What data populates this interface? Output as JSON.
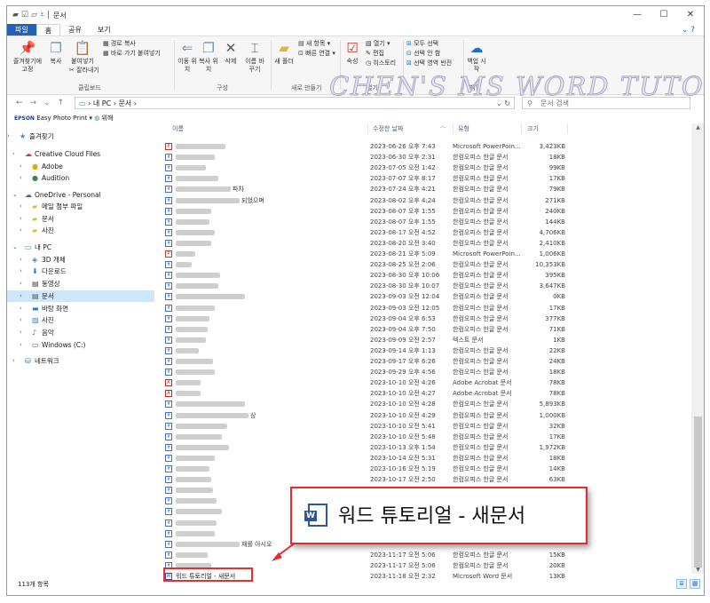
{
  "window": {
    "title": "문서",
    "minimize": "—",
    "maximize": "☐",
    "close": "✕"
  },
  "ribbon_tabs": [
    "파일",
    "홈",
    "공유",
    "보기"
  ],
  "ribbon": {
    "pin": "즐겨찾기에 고정",
    "copy": "복사",
    "paste": "붙여넣기",
    "copy_path": "경로 복사",
    "paste_shortcut": "바로 가기 붙여넣기",
    "cut": "잘라내기",
    "group_clipboard": "클립보드",
    "move": "이동 위치",
    "copy_to": "복사 위치",
    "delete": "삭제",
    "rename": "이름 바꾸기",
    "group_organize": "구성",
    "new_folder": "새 폴더",
    "new_item": "새 항목",
    "easy_access": "빠른 연결",
    "group_new": "새로 만들기",
    "properties": "속성",
    "open": "열기",
    "edit": "편집",
    "history": "히스토리",
    "group_open": "열기",
    "select_all": "모두 선택",
    "select_none": "선택 안 함",
    "invert_selection": "선택 영역 반전",
    "backup": "백업 시작",
    "group_backup": "백업"
  },
  "watermark": "CHEN'S MS WORD TUTORIAL",
  "address": {
    "path": "›  내 PC  ›  문서  ›",
    "search_placeholder": "문서 검색"
  },
  "epson": {
    "brand": "EPSON",
    "label": "Easy Photo Print",
    "extra": "위해"
  },
  "nav_pane": [
    {
      "label": "즐겨찾기",
      "icon": "★",
      "color": "#3b78d8",
      "chev": "›"
    },
    {
      "label": "Creative Cloud Files",
      "icon": "☁",
      "color": "#d33a2c",
      "chev": "›"
    },
    {
      "label": "Adobe",
      "icon": "●",
      "color": "#e0a800",
      "chev": "›"
    },
    {
      "label": "Audition",
      "icon": "●",
      "color": "#2e8b57",
      "chev": "›"
    },
    {
      "label": "OneDrive - Personal",
      "icon": "☁",
      "color": "#1f6fd1",
      "chev": "⌄"
    },
    {
      "label": "메일 첨부 파일",
      "icon": "▰",
      "color": "#e7b63a",
      "chev": "›"
    },
    {
      "label": "문서",
      "icon": "▰",
      "color": "#e7b63a",
      "chev": "›"
    },
    {
      "label": "사진",
      "icon": "▰",
      "color": "#e7b63a",
      "chev": "›"
    },
    {
      "label": "내 PC",
      "icon": "▭",
      "color": "#3a86d9",
      "chev": "⌄"
    },
    {
      "label": "3D 개체",
      "icon": "◈",
      "color": "#3a86d9",
      "chev": "›"
    },
    {
      "label": "다운로드",
      "icon": "⬇",
      "color": "#2a6fd0",
      "chev": "›"
    },
    {
      "label": "동영상",
      "icon": "▤",
      "color": "#444",
      "chev": "›"
    },
    {
      "label": "문서",
      "icon": "▤",
      "color": "#555",
      "chev": "›"
    },
    {
      "label": "바탕 화면",
      "icon": "▬",
      "color": "#2a79d2",
      "chev": "›"
    },
    {
      "label": "사진",
      "icon": "▨",
      "color": "#3a86d9",
      "chev": "›"
    },
    {
      "label": "음악",
      "icon": "♪",
      "color": "#2a6fd0",
      "chev": "›"
    },
    {
      "label": "Windows (C:)",
      "icon": "▭",
      "color": "#555",
      "chev": "›"
    },
    {
      "label": "네트워크",
      "icon": "⛁",
      "color": "#2a6fd0",
      "chev": "›"
    }
  ],
  "columns": {
    "name": "이름",
    "date": "수정한 날짜",
    "type": "유형",
    "size": "크기"
  },
  "files": [
    {
      "icon": "pp",
      "suffix": "",
      "date": "2023-06-26 오후 7:43",
      "type": "Microsoft PowerPoin...",
      "size": "3,423KB"
    },
    {
      "icon": "hwp",
      "suffix": "",
      "date": "2023-06-30 오후 2:31",
      "type": "한컴오피스 한글 문서",
      "size": "18KB"
    },
    {
      "icon": "hwp",
      "suffix": "",
      "date": "2023-07-05 오전 1:42",
      "type": "한컴오피스 한글 문서",
      "size": "99KB"
    },
    {
      "icon": "hwp",
      "suffix": "",
      "date": "2023-07-07 오후 8:17",
      "type": "한컴오피스 한글 문서",
      "size": "17KB"
    },
    {
      "icon": "hwp",
      "suffix": "파차",
      "date": "2023-07-24 오후 4:21",
      "type": "한컴오피스 한글 문서",
      "size": "79KB"
    },
    {
      "icon": "hwp",
      "suffix": "되었으며",
      "date": "2023-08-02 오후 4:24",
      "type": "한컴오피스 한글 문서",
      "size": "271KB"
    },
    {
      "icon": "hwp",
      "suffix": "",
      "date": "2023-08-07 오후 1:55",
      "type": "한컴오피스 한글 문서",
      "size": "240KB"
    },
    {
      "icon": "hwp",
      "suffix": "",
      "date": "2023-08-07 오후 1:55",
      "type": "한컴오피스 한글 문서",
      "size": "144KB"
    },
    {
      "icon": "hwp",
      "suffix": "",
      "date": "2023-08-17 오전 4:52",
      "type": "한컴오피스 한글 문서",
      "size": "4,706KB"
    },
    {
      "icon": "hwp",
      "suffix": "",
      "date": "2023-08-20 오전 3:40",
      "type": "한컴오피스 한글 문서",
      "size": "2,410KB"
    },
    {
      "icon": "pp",
      "suffix": "",
      "date": "2023-08-21 오후 5:09",
      "type": "Microsoft PowerPoin...",
      "size": "1,006KB"
    },
    {
      "icon": "hwp",
      "suffix": "",
      "date": "2023-08-25 오전 2:06",
      "type": "한컴오피스 한글 문서",
      "size": "10,353KB"
    },
    {
      "icon": "hwp",
      "suffix": "",
      "date": "2023-08-30 오후 10:06",
      "type": "한컴오피스 한글 문서",
      "size": "395KB"
    },
    {
      "icon": "hwp",
      "suffix": "",
      "date": "2023-08-30 오후 10:07",
      "type": "한컴오피스 한글 문서",
      "size": "3,647KB"
    },
    {
      "icon": "hwp",
      "suffix": "",
      "date": "2023-09-03 오전 12:04",
      "type": "한컴오피스 한글 문서",
      "size": "0KB"
    },
    {
      "icon": "hwp",
      "suffix": "",
      "date": "2023-09-03 오전 12:05",
      "type": "한컴오피스 한글 문서",
      "size": "17KB"
    },
    {
      "icon": "hwp",
      "suffix": "",
      "date": "2023-09-04 오후 6:53",
      "type": "한컴오피스 한글 문서",
      "size": "377KB"
    },
    {
      "icon": "hwp",
      "suffix": "",
      "date": "2023-09-04 오후 7:50",
      "type": "한컴오피스 한글 문서",
      "size": "71KB"
    },
    {
      "icon": "hwp",
      "suffix": "",
      "date": "2023-09-09 오전 2:57",
      "type": "텍스트 문서",
      "size": "1KB"
    },
    {
      "icon": "hwp",
      "suffix": "",
      "date": "2023-09-14 오후 1:13",
      "type": "한컴오피스 한글 문서",
      "size": "22KB"
    },
    {
      "icon": "hwp",
      "suffix": "",
      "date": "2023-09-17 오후 6:26",
      "type": "한컴오피스 한글 문서",
      "size": "24KB"
    },
    {
      "icon": "hwp",
      "suffix": "",
      "date": "2023-09-29 오후 4:56",
      "type": "한컴오피스 한글 문서",
      "size": "18KB"
    },
    {
      "icon": "pdf",
      "suffix": "",
      "date": "2023-10-10 오전 4:26",
      "type": "Adobe Acrobat 문서",
      "size": "78KB"
    },
    {
      "icon": "pdf",
      "suffix": "",
      "date": "2023-10-10 오전 4:27",
      "type": "Adobe Acrobat 문서",
      "size": "78KB"
    },
    {
      "icon": "hwp",
      "suffix": "",
      "date": "2023-10-10 오전 4:28",
      "type": "한컴오피스 한글 문서",
      "size": "5,893KB"
    },
    {
      "icon": "hwp",
      "suffix": "상",
      "date": "2023-10-10 오전 4:29",
      "type": "한컴오피스 한글 문서",
      "size": "1,000KB"
    },
    {
      "icon": "hwp",
      "suffix": "",
      "date": "2023-10-10 오전 5:41",
      "type": "한컴오피스 한글 문서",
      "size": "32KB"
    },
    {
      "icon": "hwp",
      "suffix": "",
      "date": "2023-10-10 오전 5:48",
      "type": "한컴오피스 한글 문서",
      "size": "17KB"
    },
    {
      "icon": "hwp",
      "suffix": "",
      "date": "2023-10-13 오후 1:54",
      "type": "한컴오피스 한글 문서",
      "size": "1,972KB"
    },
    {
      "icon": "hwp",
      "suffix": "",
      "date": "2023-10-14 오전 5:31",
      "type": "한컴오피스 한글 문서",
      "size": "18KB"
    },
    {
      "icon": "hwp",
      "suffix": "",
      "date": "2023-10-16 오전 5:19",
      "type": "한컴오피스 한글 문서",
      "size": "14KB"
    },
    {
      "icon": "hwp",
      "suffix": "",
      "date": "2023-10-17 오전 2:50",
      "type": "한컴오피스 한글 문서",
      "size": "63KB"
    },
    {
      "icon": "hwp",
      "suffix": "",
      "date": "",
      "type": "",
      "size": ""
    },
    {
      "icon": "hwp",
      "suffix": "",
      "date": "",
      "type": "",
      "size": ""
    },
    {
      "icon": "hwp",
      "suffix": "",
      "date": "",
      "type": "",
      "size": ""
    },
    {
      "icon": "hwp",
      "suffix": "",
      "date": "",
      "type": "",
      "size": ""
    },
    {
      "icon": "hwp",
      "suffix": "",
      "date": "",
      "type": "",
      "size": ""
    },
    {
      "icon": "hwp",
      "suffix": "재를 아시오",
      "date": "",
      "type": "",
      "size": ""
    },
    {
      "icon": "hwp",
      "suffix": "",
      "date": "2023-11-17 오전 5:06",
      "type": "한컴오피스 한글 문서",
      "size": "15KB"
    },
    {
      "icon": "hwp",
      "suffix": "",
      "date": "2023-11-17 오전 5:06",
      "type": "한컴오피스 한글 문서",
      "size": "20KB"
    },
    {
      "icon": "word",
      "name": "워드 튜토리얼 - 새문서",
      "suffix": "",
      "date": "2023-11-18 오전 2:32",
      "type": "Microsoft Word 문서",
      "size": "13KB"
    }
  ],
  "callout": {
    "text": "워드 튜토리얼 - 새문서",
    "icon": "word-icon",
    "border_color": "#e02e2e"
  },
  "status": {
    "count": "113개 항목"
  }
}
